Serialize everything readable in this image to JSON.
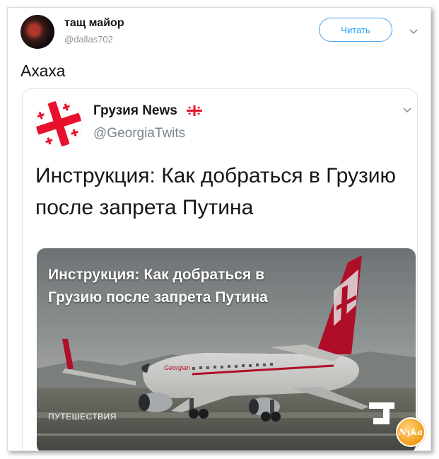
{
  "tweet": {
    "author_name": "тащ майор",
    "author_handle": "@dallas702",
    "follow_label": "Читать",
    "text": "Ахаха"
  },
  "quoted": {
    "author_name": "Грузия News",
    "author_handle": "@GeorgiaTwits",
    "text": "Инструкция: Как добраться в Грузию после запрета Путина",
    "media": {
      "headline": "Инструкция: Как добраться в Грузию после запрета Путина",
      "category": "ПУТЕШЕСТВИЯ",
      "logo": "J",
      "fuselage_text": "Georgian"
    }
  },
  "watermark": "Nyka",
  "colors": {
    "accent": "#1da1f2",
    "flag_red": "#e8112d",
    "tail_red": "#c8102e"
  },
  "icons": [
    "chevron-down-icon",
    "georgia-flag-icon",
    "plane-image",
    "brand-logo-icon"
  ]
}
